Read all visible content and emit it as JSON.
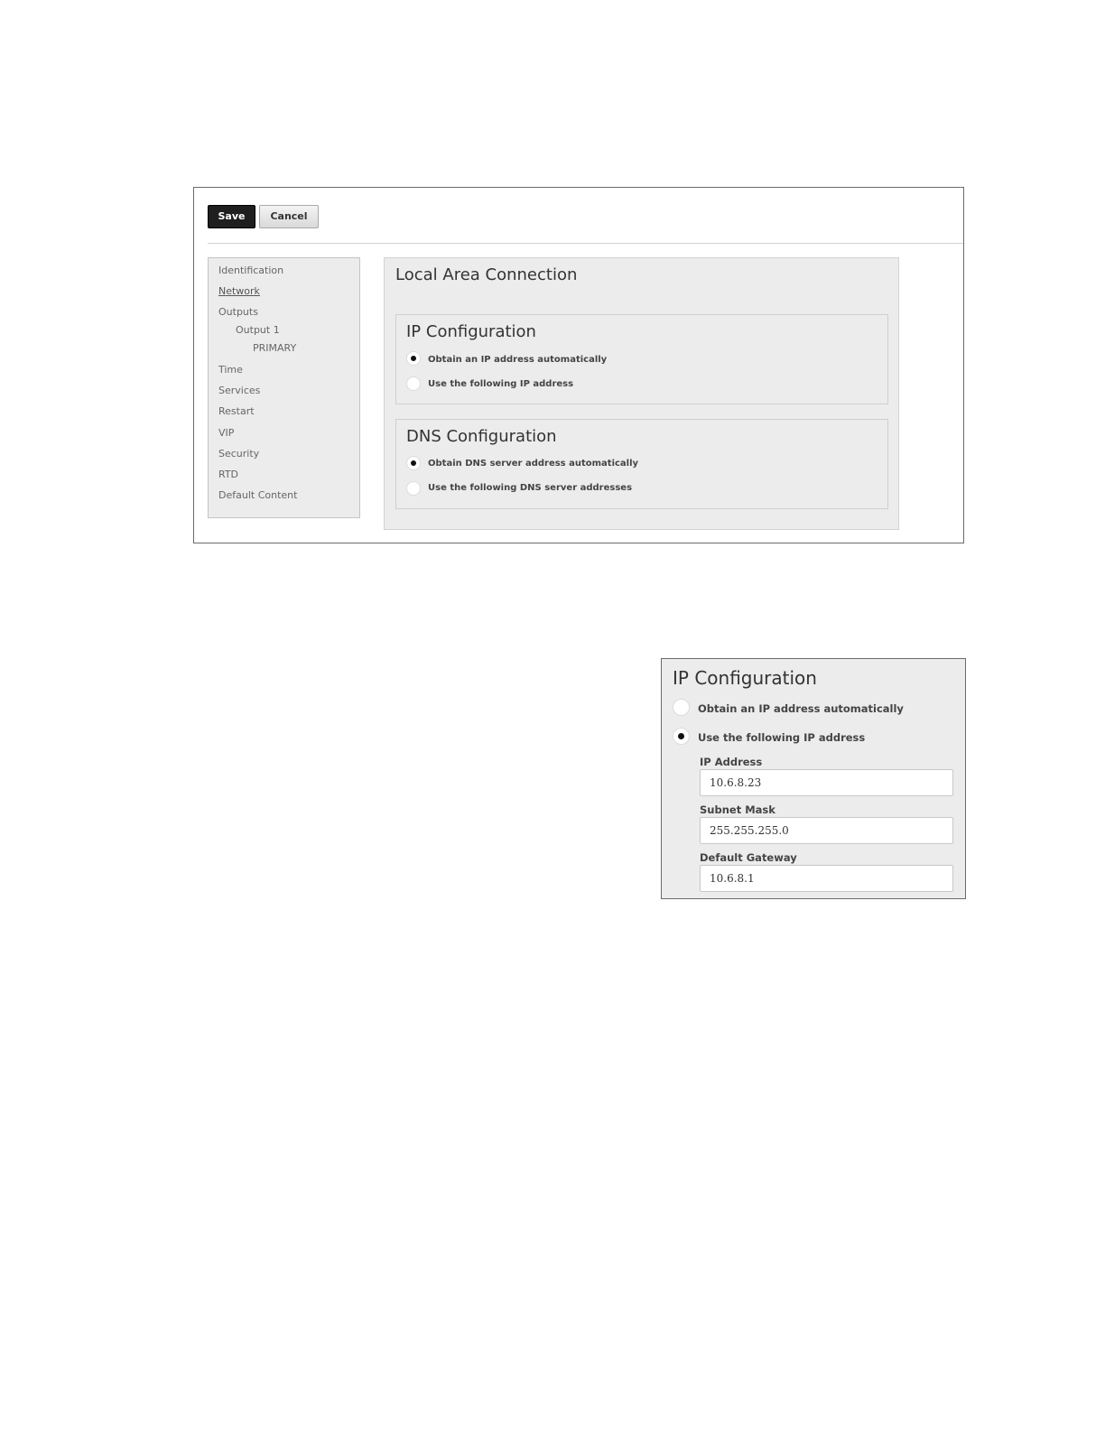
{
  "toolbar": {
    "save_label": "Save",
    "cancel_label": "Cancel"
  },
  "sidebar": {
    "items": [
      {
        "label": "Identification"
      },
      {
        "label": "Network",
        "active": true
      },
      {
        "label": "Outputs"
      },
      {
        "label": "Output 1"
      },
      {
        "label": "PRIMARY"
      },
      {
        "label": "Time"
      },
      {
        "label": "Services"
      },
      {
        "label": "Restart"
      },
      {
        "label": "VIP"
      },
      {
        "label": "Security"
      },
      {
        "label": "RTD"
      },
      {
        "label": "Default Content"
      }
    ]
  },
  "main": {
    "title": "Local Area Connection",
    "ip_config": {
      "title": "IP Configuration",
      "options": [
        {
          "label": "Obtain an IP address automatically",
          "checked": true
        },
        {
          "label": "Use the following IP address",
          "checked": false
        }
      ]
    },
    "dns_config": {
      "title": "DNS Configuration",
      "options": [
        {
          "label": "Obtain DNS server address automatically",
          "checked": true
        },
        {
          "label": "Use the following DNS server addresses",
          "checked": false
        }
      ]
    }
  },
  "detail": {
    "title": "IP Configuration",
    "options": [
      {
        "label": "Obtain an IP address automatically",
        "checked": false
      },
      {
        "label": "Use the following IP address",
        "checked": true
      }
    ],
    "fields": [
      {
        "label": "IP Address",
        "value": "10.6.8.23"
      },
      {
        "label": "Subnet Mask",
        "value": "255.255.255.0"
      },
      {
        "label": "Default Gateway",
        "value": "10.6.8.1"
      }
    ]
  }
}
